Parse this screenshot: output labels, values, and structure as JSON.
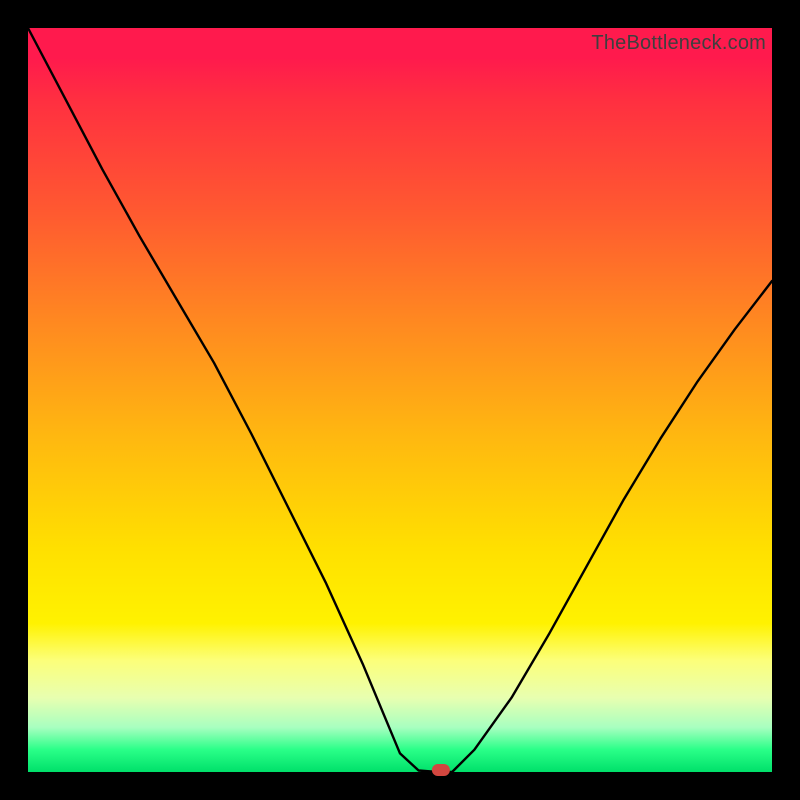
{
  "watermark": "TheBottleneck.com",
  "chart_data": {
    "type": "line",
    "title": "",
    "xlabel": "",
    "ylabel": "",
    "x": [
      0.0,
      0.05,
      0.1,
      0.15,
      0.2,
      0.25,
      0.3,
      0.35,
      0.4,
      0.45,
      0.475,
      0.5,
      0.525,
      0.55,
      0.57,
      0.6,
      0.65,
      0.7,
      0.75,
      0.8,
      0.85,
      0.9,
      0.95,
      1.0
    ],
    "values": [
      1.0,
      0.905,
      0.81,
      0.72,
      0.635,
      0.55,
      0.455,
      0.355,
      0.255,
      0.145,
      0.085,
      0.025,
      0.002,
      0.0,
      0.0,
      0.03,
      0.1,
      0.185,
      0.275,
      0.365,
      0.448,
      0.525,
      0.595,
      0.66
    ],
    "xlim": [
      0,
      1
    ],
    "ylim": [
      0,
      1
    ],
    "min_marker": {
      "x": 0.555,
      "y": 0.0
    },
    "background_gradient": [
      "#ff1a4d",
      "#ffe000",
      "#00e06a"
    ]
  }
}
